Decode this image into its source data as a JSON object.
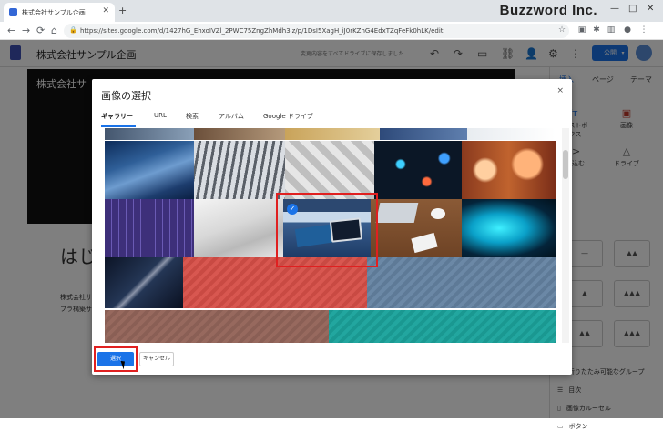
{
  "browser": {
    "tab_title": "株式会社サンプル企画",
    "new_tab": "+",
    "url": "https://sites.google.com/d/1427hG_EhxoIVZl_2PWC75ZngZhMdh3lz/p/1DsI5XagH_iJ0rKZnG4EdxTZqFeFk0hLK/edit",
    "brand": "Buzzword Inc.",
    "window_controls": [
      "—",
      "□",
      "✕"
    ]
  },
  "sites": {
    "site_title": "株式会社サンプル企画",
    "save_note": "変更内容をすべてドライブに保存しました",
    "publish": "公開",
    "hero_title": "株式会社サ",
    "page_heading": "はじ",
    "paragraph_1": "株式会社サ",
    "paragraph_2": "フラ構築サ",
    "right_panel": {
      "tabs": [
        "挿入",
        "ページ",
        "テーマ"
      ],
      "text_box": "テキストボックス",
      "image": "画像",
      "embed": "埋め込む",
      "drive": "ドライブ",
      "list": [
        "折りたたみ可能なグループ",
        "目次",
        "画像カルーセル",
        "ボタン"
      ]
    }
  },
  "dialog": {
    "title": "画像の選択",
    "close": "×",
    "tabs": [
      "ギャラリー",
      "URL",
      "検索",
      "アルバム",
      "Google ドライブ"
    ],
    "active_tab": "ギャラリー",
    "images": [
      "gallery-image-top-1",
      "gallery-image-top-2",
      "gallery-image-top-3",
      "gallery-image-top-4",
      "gallery-image-top-5",
      "blue-waves",
      "mixing-console",
      "triangle-pattern",
      "city-bokeh",
      "orange-bokeh",
      "stock-chart",
      "desk-laptop",
      "notebook-tablet-desk",
      "laptop-coffee",
      "blue-light",
      "night-sky",
      "red-texture",
      "blue-texture",
      "brown-texture",
      "teal-texture"
    ],
    "selected_image": "notebook-tablet-desk",
    "select_button": "選択",
    "cancel_button": "キャンセル"
  },
  "colors": {
    "accent": "#1a73e8",
    "highlight": "#e02020"
  }
}
